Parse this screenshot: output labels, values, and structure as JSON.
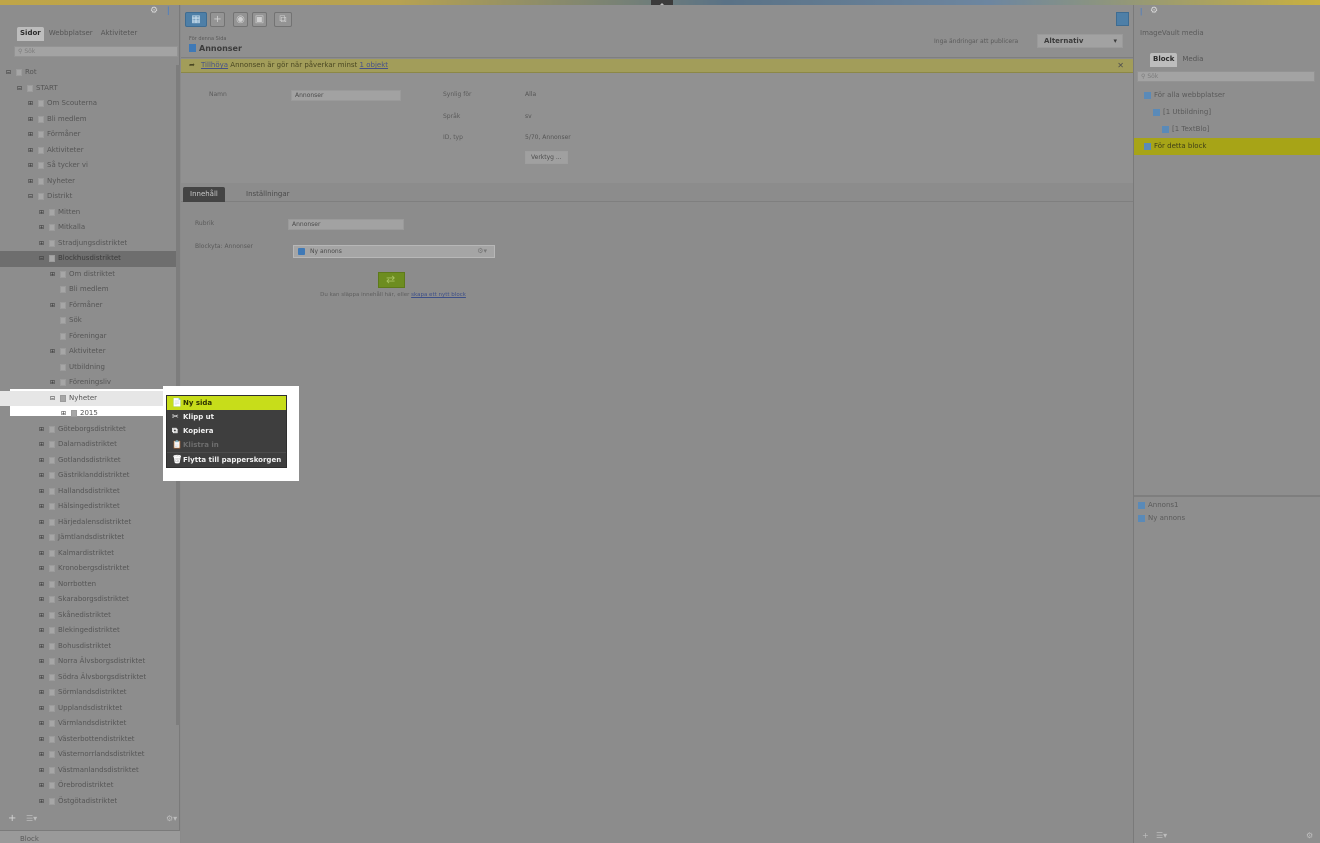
{
  "left_panel": {
    "tabs": [
      "Sidor",
      "Webbplatser",
      "Aktiviteter"
    ],
    "search_placeholder": "Sök",
    "tree": [
      {
        "label": "Rot",
        "indent": 0,
        "expander": "⊟"
      },
      {
        "label": "START",
        "indent": 1,
        "expander": "⊟"
      },
      {
        "label": "Om Scouterna",
        "indent": 2,
        "expander": "⊞"
      },
      {
        "label": "Bli medlem",
        "indent": 2,
        "expander": "⊞"
      },
      {
        "label": "Förmåner",
        "indent": 2,
        "expander": "⊞"
      },
      {
        "label": "Aktiviteter",
        "indent": 2,
        "expander": "⊞"
      },
      {
        "label": "Så tycker vi",
        "indent": 2,
        "expander": "⊞"
      },
      {
        "label": "Nyheter",
        "indent": 2,
        "expander": "⊞"
      },
      {
        "label": "Distrikt",
        "indent": 2,
        "expander": "⊟"
      },
      {
        "label": "Mitten",
        "indent": 3,
        "expander": "⊞"
      },
      {
        "label": "Mitkalla",
        "indent": 3,
        "expander": "⊞"
      },
      {
        "label": "Stradjungsdistriktet",
        "indent": 3,
        "expander": "⊞"
      },
      {
        "label": "Blockhusdistriktet",
        "indent": 3,
        "expander": "⊟",
        "selected": true
      },
      {
        "label": "Om distriktet",
        "indent": 4,
        "expander": "⊞"
      },
      {
        "label": "Bli medlem",
        "indent": 4,
        "expander": ""
      },
      {
        "label": "Förmåner",
        "indent": 4,
        "expander": "⊞"
      },
      {
        "label": "Sök",
        "indent": 4,
        "expander": ""
      },
      {
        "label": "Föreningar",
        "indent": 4,
        "expander": ""
      },
      {
        "label": "Aktiviteter",
        "indent": 4,
        "expander": "⊞"
      },
      {
        "label": "Utbildning",
        "indent": 4,
        "expander": ""
      },
      {
        "label": "Föreningsliv",
        "indent": 4,
        "expander": "⊞"
      },
      {
        "label": "Nyheter",
        "indent": 4,
        "expander": "⊟",
        "highlight": true
      },
      {
        "label": "2015",
        "indent": 5,
        "expander": "⊞"
      },
      {
        "label": "Göteborgsdistriktet",
        "indent": 3,
        "expander": "⊞"
      },
      {
        "label": "Dalarnadistriktet",
        "indent": 3,
        "expander": "⊞"
      },
      {
        "label": "Gotlandsdistriktet",
        "indent": 3,
        "expander": "⊞"
      },
      {
        "label": "Gästriklanddistriktet",
        "indent": 3,
        "expander": "⊞"
      },
      {
        "label": "Hallandsdistriktet",
        "indent": 3,
        "expander": "⊞"
      },
      {
        "label": "Hälsingedistriktet",
        "indent": 3,
        "expander": "⊞"
      },
      {
        "label": "Härjedalensdistriktet",
        "indent": 3,
        "expander": "⊞"
      },
      {
        "label": "Jämtlandsdistriktet",
        "indent": 3,
        "expander": "⊞"
      },
      {
        "label": "Kalmardistriktet",
        "indent": 3,
        "expander": "⊞"
      },
      {
        "label": "Kronobergsdistriktet",
        "indent": 3,
        "expander": "⊞"
      },
      {
        "label": "Norrbotten",
        "indent": 3,
        "expander": "⊞"
      },
      {
        "label": "Skaraborgsdistriktet",
        "indent": 3,
        "expander": "⊞"
      },
      {
        "label": "Skånedistriktet",
        "indent": 3,
        "expander": "⊞"
      },
      {
        "label": "Blekingedistriktet",
        "indent": 3,
        "expander": "⊞"
      },
      {
        "label": "Bohusdistriktet",
        "indent": 3,
        "expander": "⊞"
      },
      {
        "label": "Norra Älvsborgsdistriktet",
        "indent": 3,
        "expander": "⊞"
      },
      {
        "label": "Södra Älvsborgsdistriktet",
        "indent": 3,
        "expander": "⊞"
      },
      {
        "label": "Sörmlandsdistriktet",
        "indent": 3,
        "expander": "⊞"
      },
      {
        "label": "Upplandsdistriktet",
        "indent": 3,
        "expander": "⊞"
      },
      {
        "label": "Värmlandsdistriktet",
        "indent": 3,
        "expander": "⊞"
      },
      {
        "label": "Västerbottendistriktet",
        "indent": 3,
        "expander": "⊞"
      },
      {
        "label": "Västernorrlandsdistriktet",
        "indent": 3,
        "expander": "⊞"
      },
      {
        "label": "Västmanlandsdistriktet",
        "indent": 3,
        "expander": "⊞"
      },
      {
        "label": "Örebrodistriktet",
        "indent": 3,
        "expander": "⊞"
      },
      {
        "label": "Östgötadistriktet",
        "indent": 3,
        "expander": "⊞"
      }
    ],
    "bottom_label": "Block"
  },
  "toolbar": {
    "breadcrumb": "För denna Sida",
    "page_title": "Annonser",
    "status": "Inga ändringar att publicera",
    "alternatives_label": "Alternativ"
  },
  "notice": {
    "link_text": "Tillhöya",
    "message": "Annonsen är gör när påverkar minst",
    "count_link": "1 objekt"
  },
  "properties": {
    "name_label": "Namn",
    "name_value": "Annonser",
    "visible_label": "Synlig för",
    "visible_value": "Alla",
    "language_label": "Språk",
    "language_value": "sv",
    "id_type_label": "ID, typ",
    "id_type_value": "5/70, Annonser",
    "tools_button": "Verktyg ..."
  },
  "content_tabs": [
    "Innehåll",
    "Inställningar"
  ],
  "content": {
    "heading_label": "Rubrik",
    "heading_value": "Annonser",
    "block_area_label": "Blockyta: Annonser",
    "block_item": "Ny annons",
    "drop_hint": "Du kan släppa innehåll här, eller",
    "drop_link": "skapa ett nytt block"
  },
  "right_panel": {
    "title": "ImageVault media",
    "tabs": [
      "Block",
      "Media"
    ],
    "search_placeholder": "Sök",
    "tree": [
      {
        "label": "För alla webbplatser",
        "indent": 0
      },
      {
        "label": "[1 Utbildning]",
        "indent": 1
      },
      {
        "label": "[1 TextBlo]",
        "indent": 2
      },
      {
        "label": "För detta block",
        "indent": 0,
        "selected": true
      }
    ],
    "list": [
      "Annons1",
      "Ny annons"
    ]
  },
  "context_menu": {
    "items": [
      {
        "label": "Ny sida",
        "icon": "📄",
        "state": "active"
      },
      {
        "label": "Klipp ut",
        "icon": "✂",
        "state": "normal"
      },
      {
        "label": "Kopiera",
        "icon": "⧉",
        "state": "normal"
      },
      {
        "label": "Klistra in",
        "icon": "📋",
        "state": "disabled"
      },
      {
        "label": "Flytta till papperskorgen",
        "icon": "🗑",
        "state": "normal"
      }
    ]
  },
  "colors": {
    "accent_green": "#c7dd1a",
    "selected_yellow": "#a7a417",
    "primary_blue": "#4e7fa7"
  }
}
